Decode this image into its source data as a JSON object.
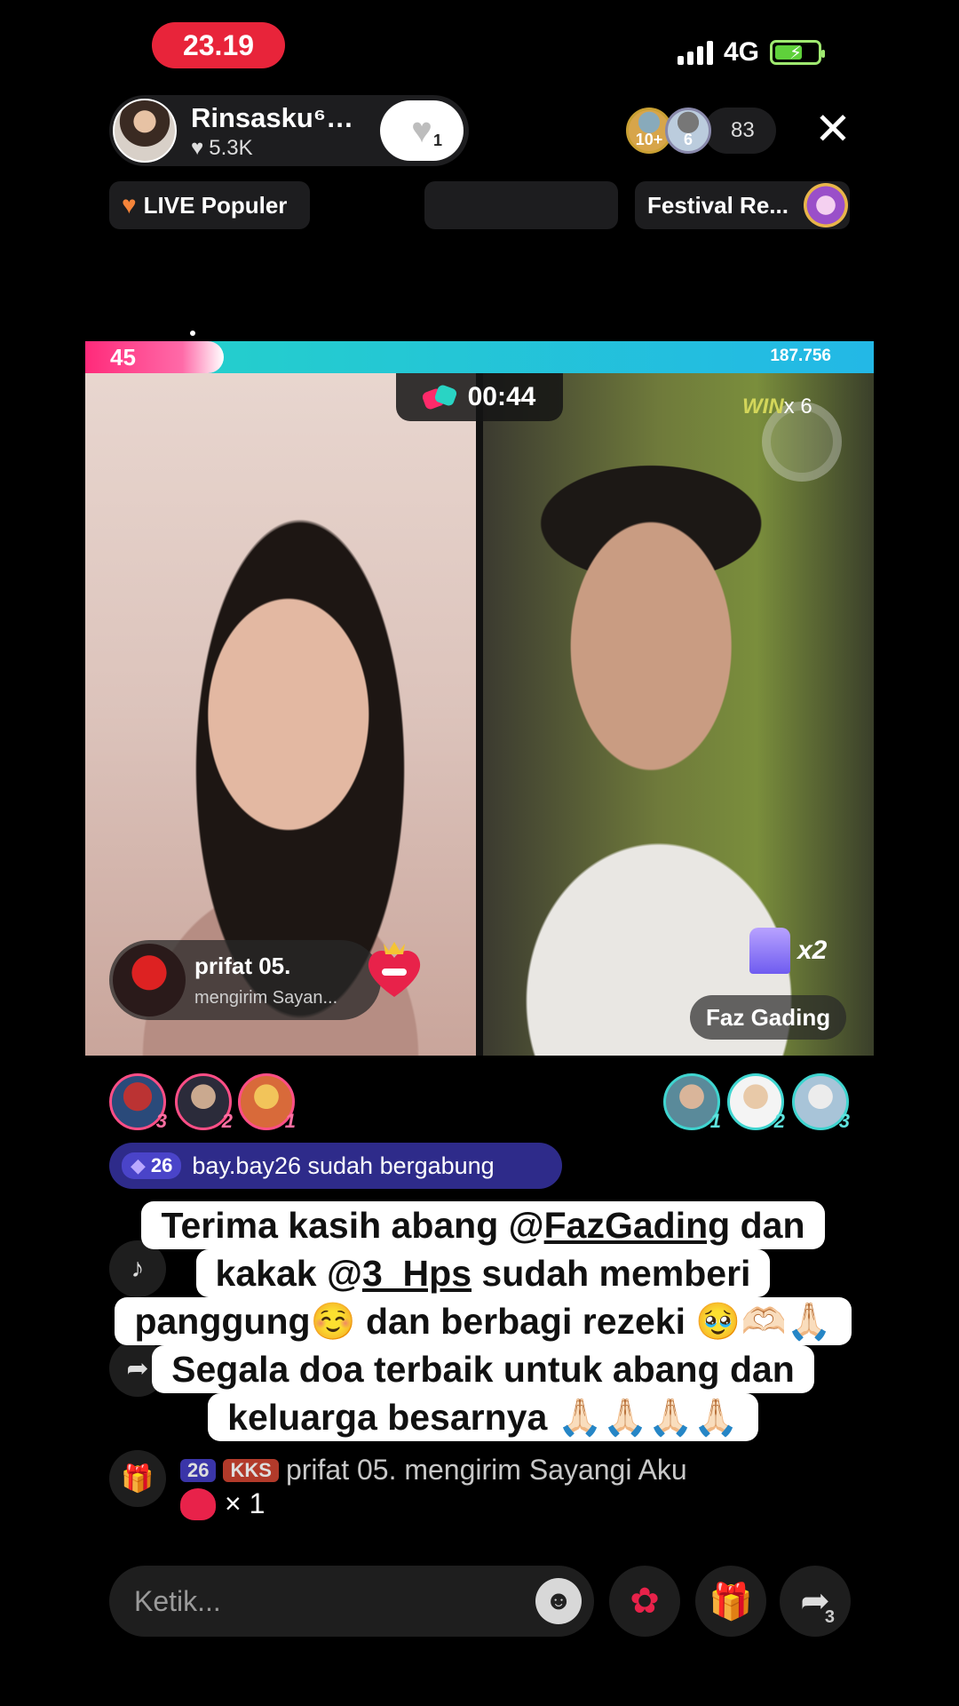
{
  "status": {
    "time": "23.19",
    "network": "4G"
  },
  "host": {
    "name": "Rinsasku⁶…",
    "likes": "5.3K",
    "follow_count": "1"
  },
  "viewers": {
    "badge_a": "10+",
    "badge_b": "6",
    "count": "83"
  },
  "chips": {
    "popular": "LIVE Populer",
    "festival": "Festival Re..."
  },
  "battle": {
    "left_score": "45",
    "right_score": "187.756",
    "timer": "00:44",
    "win_label": "WIN",
    "win_multiplier": "x 6",
    "gift_sender": "prifat 05.",
    "gift_text": "mengirim Sayan...",
    "gift_multiplier": "x2",
    "guest_name": "Faz Gading"
  },
  "gifters_left": [
    "3",
    "2",
    "1"
  ],
  "gifters_right": [
    "1",
    "2",
    "3"
  ],
  "join": {
    "level": "26",
    "text": "bay.bay26 sudah bergabung"
  },
  "caption": {
    "l1a": "Terima kasih abang @",
    "l1u": "FazGading",
    "l1b": " dan",
    "l2a": "kakak @",
    "l2u": "3_Hps",
    "l2b": "  sudah memberi",
    "l3": "panggung☺️ dan berbagi rezeki  🥹🫶🏻🙏🏻",
    "l4": "Segala doa terbaik untuk abang dan",
    "l5": "keluarga besarnya 🙏🏻🙏🏻🙏🏻🙏🏻"
  },
  "comment": {
    "level": "26",
    "tag": "KKS",
    "text": "prifat 05. mengirim Sayangi Aku",
    "count": "× 1"
  },
  "input": {
    "placeholder": "Ketik..."
  },
  "share_count": "3",
  "colors": {
    "accent_pink": "#ff2a7a",
    "accent_teal": "#24d2c8",
    "clock_red": "#e8243a"
  }
}
